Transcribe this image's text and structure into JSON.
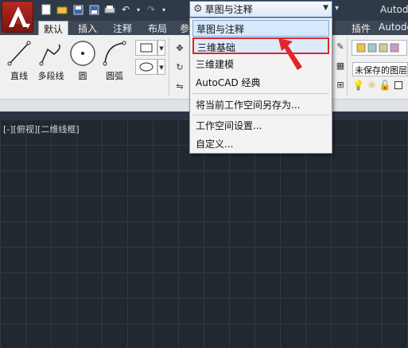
{
  "window": {
    "app_title": "Autode"
  },
  "quick_access": {
    "icons": [
      "new-file-icon",
      "open-folder-icon",
      "save-icon",
      "save-as-icon",
      "print-icon",
      "undo-icon",
      "redo-icon"
    ]
  },
  "workspace_combo": {
    "value": "草图与注释"
  },
  "ribbon_tabs": [
    {
      "label": "默认",
      "active": true
    },
    {
      "label": "插入",
      "active": false
    },
    {
      "label": "注释",
      "active": false
    },
    {
      "label": "布局",
      "active": false
    },
    {
      "label": "参",
      "active": false
    },
    {
      "label": "插件",
      "active": false
    },
    {
      "label": "Autodesk",
      "active": false
    }
  ],
  "draw_tools": [
    {
      "label": "直线",
      "icon": "line-icon"
    },
    {
      "label": "多段线",
      "icon": "polyline-icon"
    },
    {
      "label": "圆",
      "icon": "circle-icon"
    },
    {
      "label": "圆弧",
      "icon": "arc-icon"
    }
  ],
  "layer_panel": {
    "layer_state": "未保存的图层"
  },
  "viewport": {
    "label": "[-][俯视][二维线框]"
  },
  "workspace_menu": {
    "items": [
      {
        "label": "草图与注释",
        "state": "current"
      },
      {
        "label": "三维基础",
        "state": "highlighted"
      },
      {
        "label": "三维建模",
        "state": "normal"
      },
      {
        "label": "AutoCAD 经典",
        "state": "normal"
      }
    ],
    "actions": [
      {
        "label": "将当前工作空间另存为..."
      },
      {
        "label": "工作空间设置..."
      },
      {
        "label": "自定义..."
      }
    ]
  },
  "colors": {
    "canvas_bg": "#212830",
    "ribbon_bg": "#f0f0f0",
    "highlight_border": "#e1262a",
    "selected_bg": "#d6e8fb"
  }
}
